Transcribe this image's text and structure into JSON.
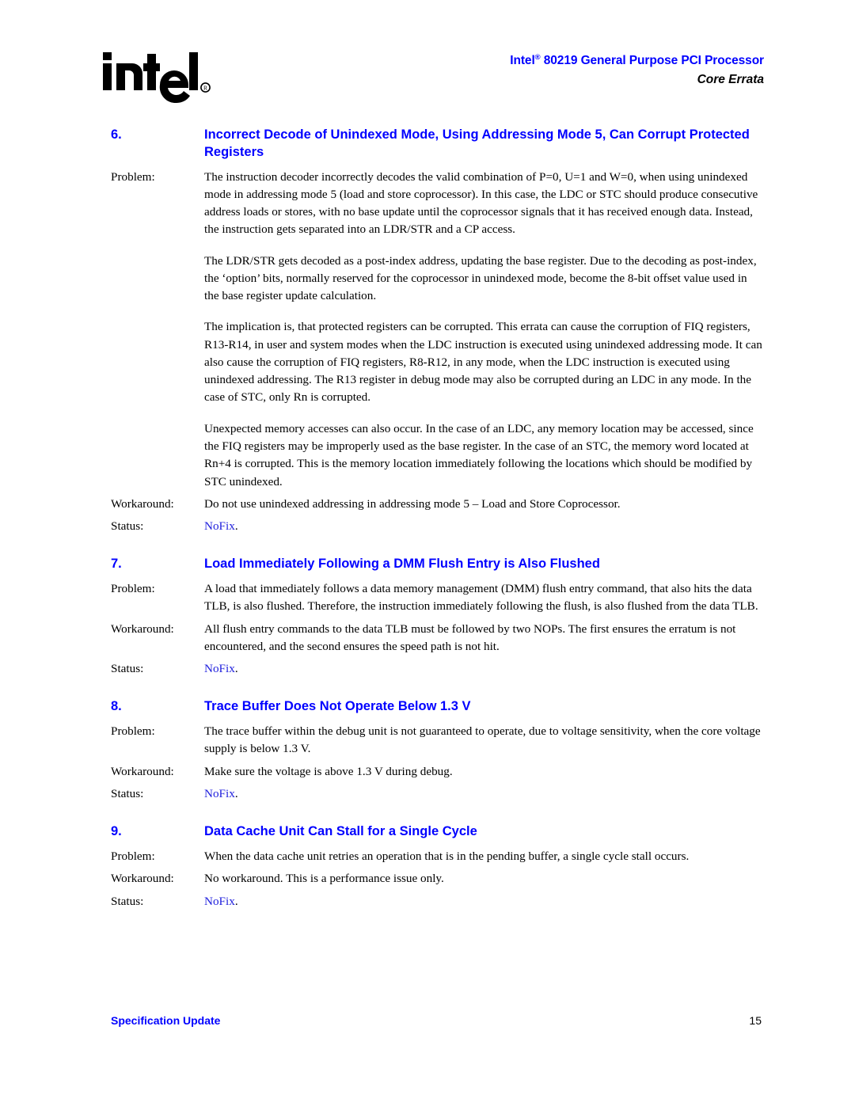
{
  "header": {
    "logo_name": "intel-logo",
    "logo_text": "intel",
    "logo_registered": "®",
    "title": "Intel® 80219 General Purpose PCI Processor",
    "title_main": "Intel",
    "title_sup": "®",
    "title_rest": " 80219 General Purpose PCI Processor",
    "subtitle": "Core Errata",
    "title_color": "#0000ff",
    "subtitle_color": "#000000"
  },
  "labels": {
    "problem": "Problem:",
    "workaround": "Workaround:",
    "status": "Status:"
  },
  "status_value": "NoFix",
  "status_period": ".",
  "errata": [
    {
      "number": "6.",
      "title": "Incorrect Decode of Unindexed Mode, Using Addressing Mode 5, Can Corrupt Protected Registers",
      "problem_paragraphs": [
        "The instruction decoder incorrectly decodes the valid combination of P=0, U=1 and W=0, when using unindexed mode in addressing mode 5 (load and store coprocessor). In this case, the LDC or STC should produce consecutive address loads or stores, with no base update until the coprocessor signals that it has received enough data. Instead, the instruction gets separated into an LDR/STR and a CP access.",
        "The LDR/STR gets decoded as a post-index address, updating the base register. Due to the decoding as post-index, the ‘option’ bits, normally reserved for the coprocessor in unindexed mode, become the 8-bit offset value used in the base register update calculation.",
        "The implication is, that protected registers can be corrupted. This errata can cause the corruption of FIQ registers, R13-R14, in user and system modes when the LDC instruction is executed using unindexed addressing mode. It can also cause the corruption of FIQ registers, R8-R12, in any mode, when the LDC instruction is executed using unindexed addressing. The R13 register in debug mode may also be corrupted during an LDC in any mode. In the case of STC, only Rn is corrupted.",
        "Unexpected memory accesses can also occur. In the case of an LDC, any memory location may be accessed, since the FIQ registers may be improperly used as the base register. In the case of an STC, the memory word located at Rn+4 is corrupted. This is the memory location immediately following the locations which should be modified by STC unindexed."
      ],
      "workaround": "Do not use unindexed addressing in addressing mode 5 – Load and Store Coprocessor."
    },
    {
      "number": "7.",
      "title": "Load Immediately Following a DMM Flush Entry is Also Flushed",
      "problem_paragraphs": [
        "A load that immediately follows a data memory management (DMM) flush entry command, that also hits the data TLB, is also flushed. Therefore, the instruction immediately following the flush, is also flushed from the data TLB."
      ],
      "workaround": "All flush entry commands to the data TLB must be followed by two NOPs. The first ensures the erratum is not encountered, and the second ensures the speed path is not hit."
    },
    {
      "number": "8.",
      "title": "Trace Buffer Does Not Operate Below 1.3 V",
      "problem_paragraphs": [
        "The trace buffer within the debug unit is not guaranteed to operate, due to voltage sensitivity, when the core voltage supply is below 1.3 V."
      ],
      "workaround": "Make sure the voltage is above 1.3 V during debug."
    },
    {
      "number": "9.",
      "title": "Data Cache Unit Can Stall for a Single Cycle",
      "problem_paragraphs": [
        "When the data cache unit retries an operation that is in the pending buffer, a single cycle stall occurs."
      ],
      "workaround": "No workaround. This is a performance issue only."
    }
  ],
  "footer": {
    "left": "Specification Update",
    "page_number": "15"
  }
}
